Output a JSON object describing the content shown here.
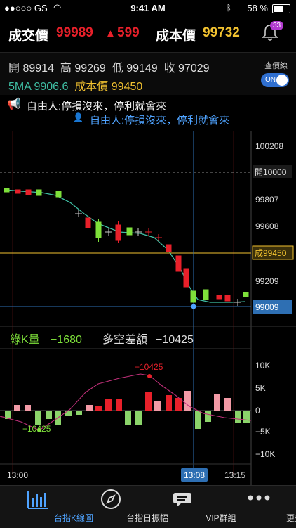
{
  "status_bar": {
    "carrier": "●●○○○ GS",
    "time": "9:41 AM",
    "battery": "58 %"
  },
  "header": {
    "trade_label": "成交價",
    "trade_price": "99989",
    "change_arrow": "▲",
    "change": "599",
    "cost_label": "成本價",
    "cost_price": "99732",
    "badge_count": "33"
  },
  "ohlc": {
    "open_label": "開",
    "open": "89914",
    "high_label": "高",
    "high": "99269",
    "low_label": "低",
    "low": "99149",
    "close_label": "收",
    "close": "97029"
  },
  "ma": {
    "ma_label": "5MA",
    "ma_value": "9906.6",
    "cost_label": "成本價",
    "cost_value": "99450"
  },
  "toggle": {
    "label": "查價線",
    "state": "ON"
  },
  "messages": {
    "line1": "自由人:停損沒來，停利就會來",
    "line2": "自由人:停損沒來，停利就會來"
  },
  "price_axis": {
    "ticks": [
      "100208",
      "開10000",
      "99807",
      "99608",
      "成99450",
      "99209",
      "99009"
    ]
  },
  "indicator": {
    "green_label": "綠K量",
    "green_value": "−1680",
    "diff_label": "多空差額",
    "diff_value": "−10425",
    "ticks": [
      "10K",
      "5K",
      "0",
      "−5K",
      "−10K"
    ],
    "max_label": "−10425",
    "min_label": "−10425"
  },
  "time_axis": {
    "start": "13:00",
    "cursor": "13:08",
    "end": "13:15"
  },
  "tabs": [
    {
      "label": "台指K線圖",
      "icon": "bar-chart-icon",
      "active": true
    },
    {
      "label": "台指日振幅",
      "icon": "compass-icon",
      "active": false
    },
    {
      "label": "VIP群組",
      "icon": "chat-bubble-icon",
      "active": false
    },
    {
      "label": "更多",
      "icon": "more-dots-icon",
      "active": false
    }
  ],
  "colors": {
    "up": "#e8202a",
    "down": "#7ee03a",
    "cost": "#f2c230",
    "ma": "#3fbfa4",
    "accent": "#4fa3ff",
    "axis_highlight": "#2e6fb3"
  }
}
